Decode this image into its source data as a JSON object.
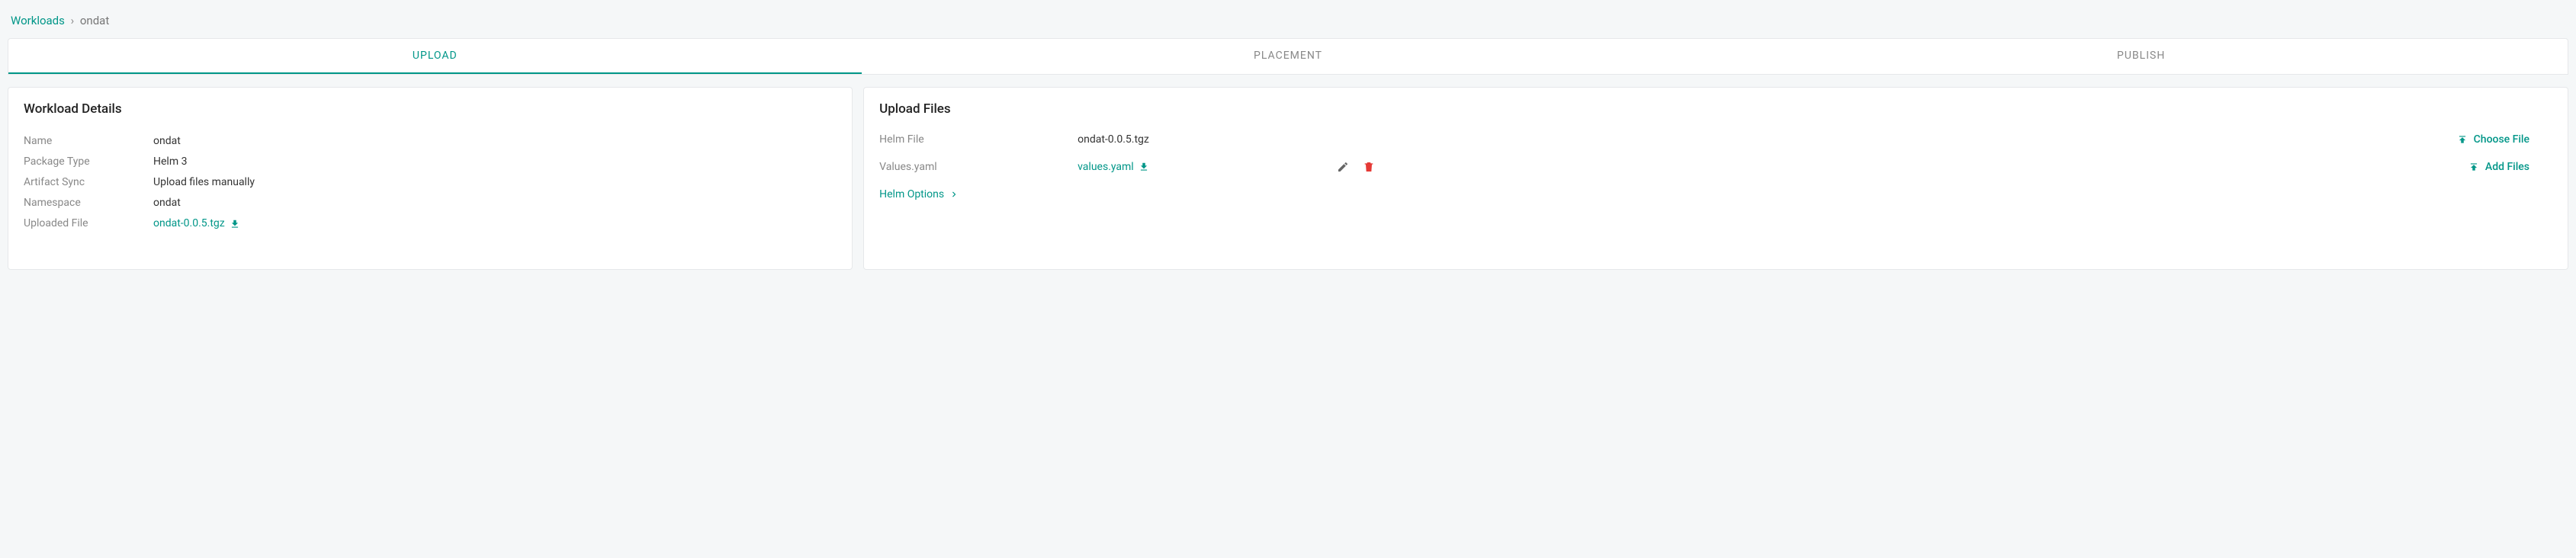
{
  "breadcrumb": {
    "root": "Workloads",
    "separator": "›",
    "current": "ondat"
  },
  "tabs": {
    "upload": "UPLOAD",
    "placement": "PLACEMENT",
    "publish": "PUBLISH"
  },
  "details": {
    "title": "Workload Details",
    "rows": {
      "name_label": "Name",
      "name_value": "ondat",
      "package_type_label": "Package Type",
      "package_type_value": "Helm 3",
      "artifact_sync_label": "Artifact Sync",
      "artifact_sync_value": "Upload files manually",
      "namespace_label": "Namespace",
      "namespace_value": "ondat",
      "uploaded_file_label": "Uploaded File",
      "uploaded_file_value": "ondat-0.0.5.tgz"
    }
  },
  "upload": {
    "title": "Upload Files",
    "helm_file_label": "Helm File",
    "helm_file_value": "ondat-0.0.5.tgz",
    "values_yaml_label": "Values.yaml",
    "values_yaml_value": "values.yaml",
    "choose_file_label": "Choose File",
    "add_files_label": "Add Files",
    "helm_options_label": "Helm Options"
  }
}
